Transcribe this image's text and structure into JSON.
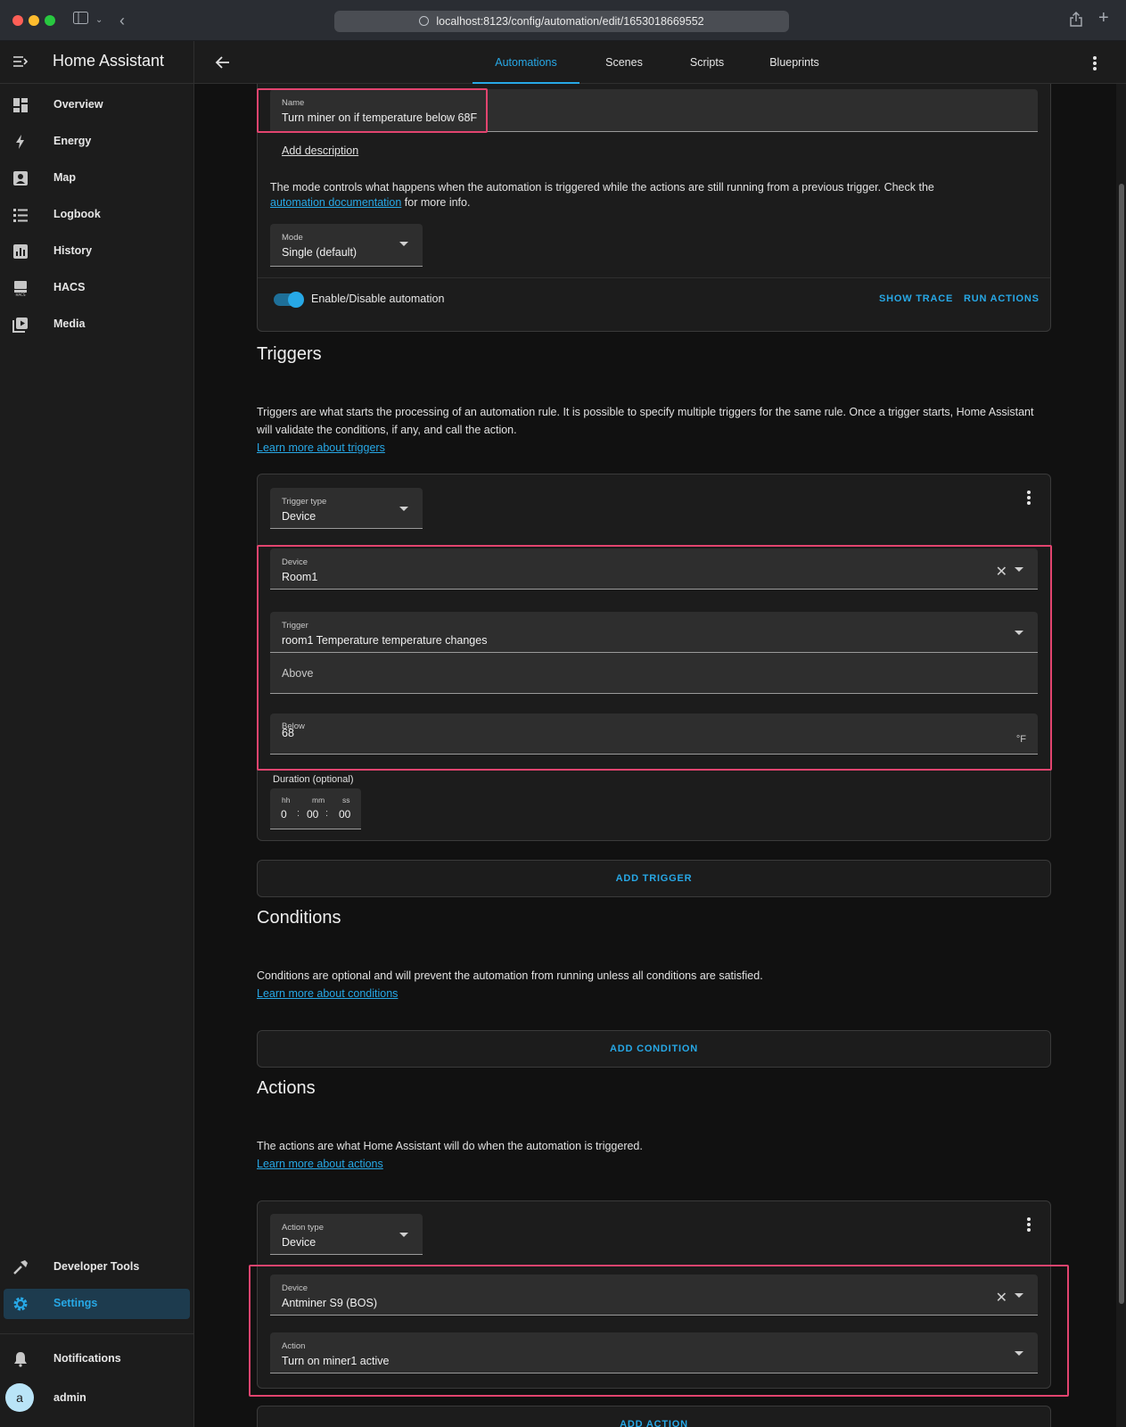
{
  "browser": {
    "url": "localhost:8123/config/automation/edit/1653018669552"
  },
  "sidebar": {
    "title": "Home Assistant",
    "items": [
      {
        "label": "Overview",
        "icon": "dashboard-icon"
      },
      {
        "label": "Energy",
        "icon": "lightning-icon"
      },
      {
        "label": "Map",
        "icon": "map-icon"
      },
      {
        "label": "Logbook",
        "icon": "logbook-icon"
      },
      {
        "label": "History",
        "icon": "chart-icon"
      },
      {
        "label": "HACS",
        "icon": "hacs-icon"
      },
      {
        "label": "Media",
        "icon": "media-icon"
      }
    ],
    "bottom_items": [
      {
        "label": "Developer Tools",
        "icon": "hammer-icon"
      },
      {
        "label": "Settings",
        "icon": "gear-icon"
      }
    ],
    "notifications_label": "Notifications",
    "user": {
      "initial": "a",
      "name": "admin"
    }
  },
  "header": {
    "tabs": [
      "Automations",
      "Scenes",
      "Scripts",
      "Blueprints"
    ],
    "active_tab": "Automations"
  },
  "details": {
    "name_label": "Name",
    "name_value": "Turn miner on if temperature below 68F",
    "add_description": "Add description",
    "mode_text_before": "The mode controls what happens when the automation is triggered while the actions are still running from a previous trigger. Check the ",
    "mode_link": "automation documentation",
    "mode_text_after": " for more info.",
    "mode_label": "Mode",
    "mode_value": "Single (default)",
    "enable_label": "Enable/Disable automation",
    "show_trace": "SHOW TRACE",
    "run_actions": "RUN ACTIONS"
  },
  "triggers": {
    "heading": "Triggers",
    "description": "Triggers are what starts the processing of an automation rule. It is possible to specify multiple triggers for the same rule. Once a trigger starts, Home Assistant will validate the conditions, if any, and call the action.",
    "learn_more": "Learn more about triggers",
    "trigger_type_label": "Trigger type",
    "trigger_type_value": "Device",
    "device_label": "Device",
    "device_value": "Room1",
    "trigger_label": "Trigger",
    "trigger_value": "room1 Temperature temperature changes",
    "above_label": "Above",
    "below_label": "Below",
    "below_value": "68",
    "below_unit": "°F",
    "duration_label": "Duration (optional)",
    "duration": {
      "hh_label": "hh",
      "mm_label": "mm",
      "ss_label": "ss",
      "hh": "0",
      "mm": "00",
      "ss": "00"
    },
    "add_button": "ADD TRIGGER"
  },
  "conditions": {
    "heading": "Conditions",
    "description": "Conditions are optional and will prevent the automation from running unless all conditions are satisfied.",
    "learn_more": "Learn more about conditions",
    "add_button": "ADD CONDITION"
  },
  "actions": {
    "heading": "Actions",
    "description": "The actions are what Home Assistant will do when the automation is triggered.",
    "learn_more": "Learn more about actions",
    "action_type_label": "Action type",
    "action_type_value": "Device",
    "device_label": "Device",
    "device_value": "Antminer S9 (BOS)",
    "action_label": "Action",
    "action_value": "Turn on miner1 active",
    "add_button": "ADD ACTION"
  },
  "colors": {
    "accent": "#27a8e6",
    "highlight": "#e2446f",
    "background": "#111111",
    "card": "#1c1c1c"
  }
}
